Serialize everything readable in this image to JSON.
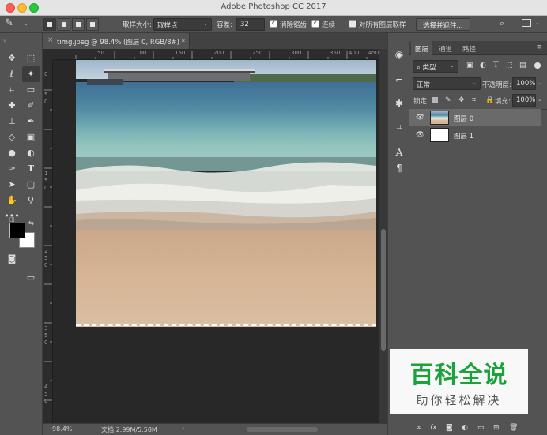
{
  "window": {
    "title": "Adobe Photoshop CC 2017"
  },
  "options_bar": {
    "sample_size_label": "取样大小:",
    "sample_size_value": "取样点",
    "tolerance_label": "容差:",
    "tolerance_value": "32",
    "anti_alias_label": "消除锯齿",
    "anti_alias_checked": true,
    "contiguous_label": "连续",
    "contiguous_checked": true,
    "sample_all_label": "对所有图层取样",
    "sample_all_checked": false,
    "select_mask_button": "选择并遮住..."
  },
  "document": {
    "tab_title": "timg.jpeg @ 98.4% (图层 0, RGB/8#) *",
    "ruler_h_labels": [
      "50",
      "100",
      "150",
      "200",
      "250",
      "300",
      "350",
      "400",
      "450"
    ],
    "ruler_v_labels": [
      "0",
      "5",
      "0",
      "1",
      "5",
      "0",
      "2",
      "5",
      "0",
      "3",
      "5",
      "0",
      "4",
      "5",
      "0"
    ],
    "zoom": "98.4%",
    "doc_info": "文档:2.99M/5.58M"
  },
  "tools": [
    "move-tool",
    "marquee-tool",
    "lasso-tool",
    "magic-wand-tool",
    "crop-tool",
    "measure-tool",
    "healing-brush-tool",
    "brush-tool",
    "clone-stamp-tool",
    "history-brush-tool",
    "eraser-tool",
    "gradient-tool",
    "blur-tool",
    "dodge-tool",
    "pen-tool",
    "type-tool",
    "path-selection-tool",
    "shape-tool",
    "hand-tool",
    "zoom-tool",
    "more-tools"
  ],
  "layers_panel": {
    "tabs": [
      "图层",
      "通道",
      "路径"
    ],
    "filter_label": "类型",
    "blend_mode": "正常",
    "opacity_label": "不透明度:",
    "opacity_value": "100%",
    "lock_label": "锁定:",
    "fill_label": "填充:",
    "fill_value": "100%",
    "layers": [
      {
        "name": "图层 0",
        "selected": true
      },
      {
        "name": "图层 1",
        "selected": false
      }
    ]
  },
  "watermark": {
    "title": "百科全说",
    "subtitle": "助你轻松解决"
  },
  "colors": {
    "foreground": "#000000",
    "background": "#ffffff",
    "app_bg": "#535353",
    "canvas_bg": "#282828"
  }
}
